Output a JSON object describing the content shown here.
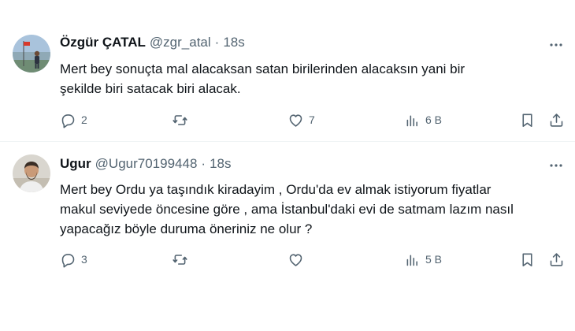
{
  "tweets": [
    {
      "name": "Özgür ÇATAL",
      "handle": "@zgr_atal",
      "separator": "·",
      "time": "18s",
      "text_lines": [
        "Mert bey sonuçta  mal alacaksan satan birilerinden alacaksın yani bir",
        "şekilde biri satacak biri alacak."
      ],
      "replies": "2",
      "retweets": "",
      "likes": "7",
      "views": "6 B"
    },
    {
      "name": "Ugur",
      "handle": "@Ugur70199448",
      "separator": "·",
      "time": "18s",
      "text_lines": [
        "Mert bey Ordu ya taşındık kiradayim , Ordu'da ev almak istiyorum fiyatlar",
        "makul seviyede öncesine göre , ama İstanbul'daki evi de satmam lazım nasıl",
        "yapacağız böyle duruma öneriniz ne olur ?"
      ],
      "replies": "3",
      "retweets": "",
      "likes": "",
      "views": "5 B"
    }
  ],
  "icons": {
    "reply": "reply-icon",
    "retweet": "retweet-icon",
    "like": "heart-icon",
    "views": "views-icon",
    "bookmark": "bookmark-icon",
    "share": "share-icon",
    "more": "more-icon"
  },
  "colors": {
    "text": "#0f1419",
    "secondary": "#536471",
    "divider": "#eff3f4"
  }
}
